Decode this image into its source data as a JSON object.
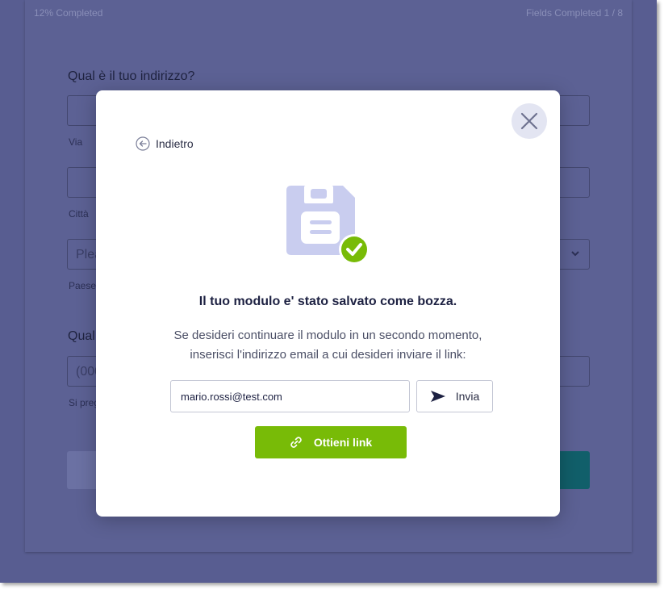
{
  "progress": {
    "completed_label": "12%  Completed",
    "fields_label": "Fields Completed  1 / 8"
  },
  "background_form": {
    "question_address": "Qual è il tuo indirizzo?",
    "street_label": "Via",
    "city_label": "Città",
    "country_placeholder": "Plea",
    "country_label": "Paese",
    "question_phone": "Qual",
    "phone_placeholder": "(000",
    "phone_hint": "Si preg"
  },
  "modal": {
    "back_label": "Indietro",
    "title": "Il tuo modulo e' stato salvato come bozza.",
    "description_line1": "Se desideri continuare il modulo in un secondo momento,",
    "description_line2": "inserisci l'indirizzo email a cui desideri inviare il link:",
    "email_value": "mario.rossi@test.com",
    "send_label": "Invia",
    "get_link_label": "Ottieni link",
    "icons": {
      "close": "close-icon",
      "back": "arrow-left-circle-icon",
      "save": "floppy-disk-icon",
      "check": "check-circle-icon",
      "send": "send-icon",
      "link": "link-icon"
    }
  },
  "colors": {
    "overlay": "#585d91",
    "accent_green": "#78bb07",
    "icon_lavender": "#c9cdef",
    "close_bg": "#e3e5f2",
    "teal": "#115f6a"
  }
}
